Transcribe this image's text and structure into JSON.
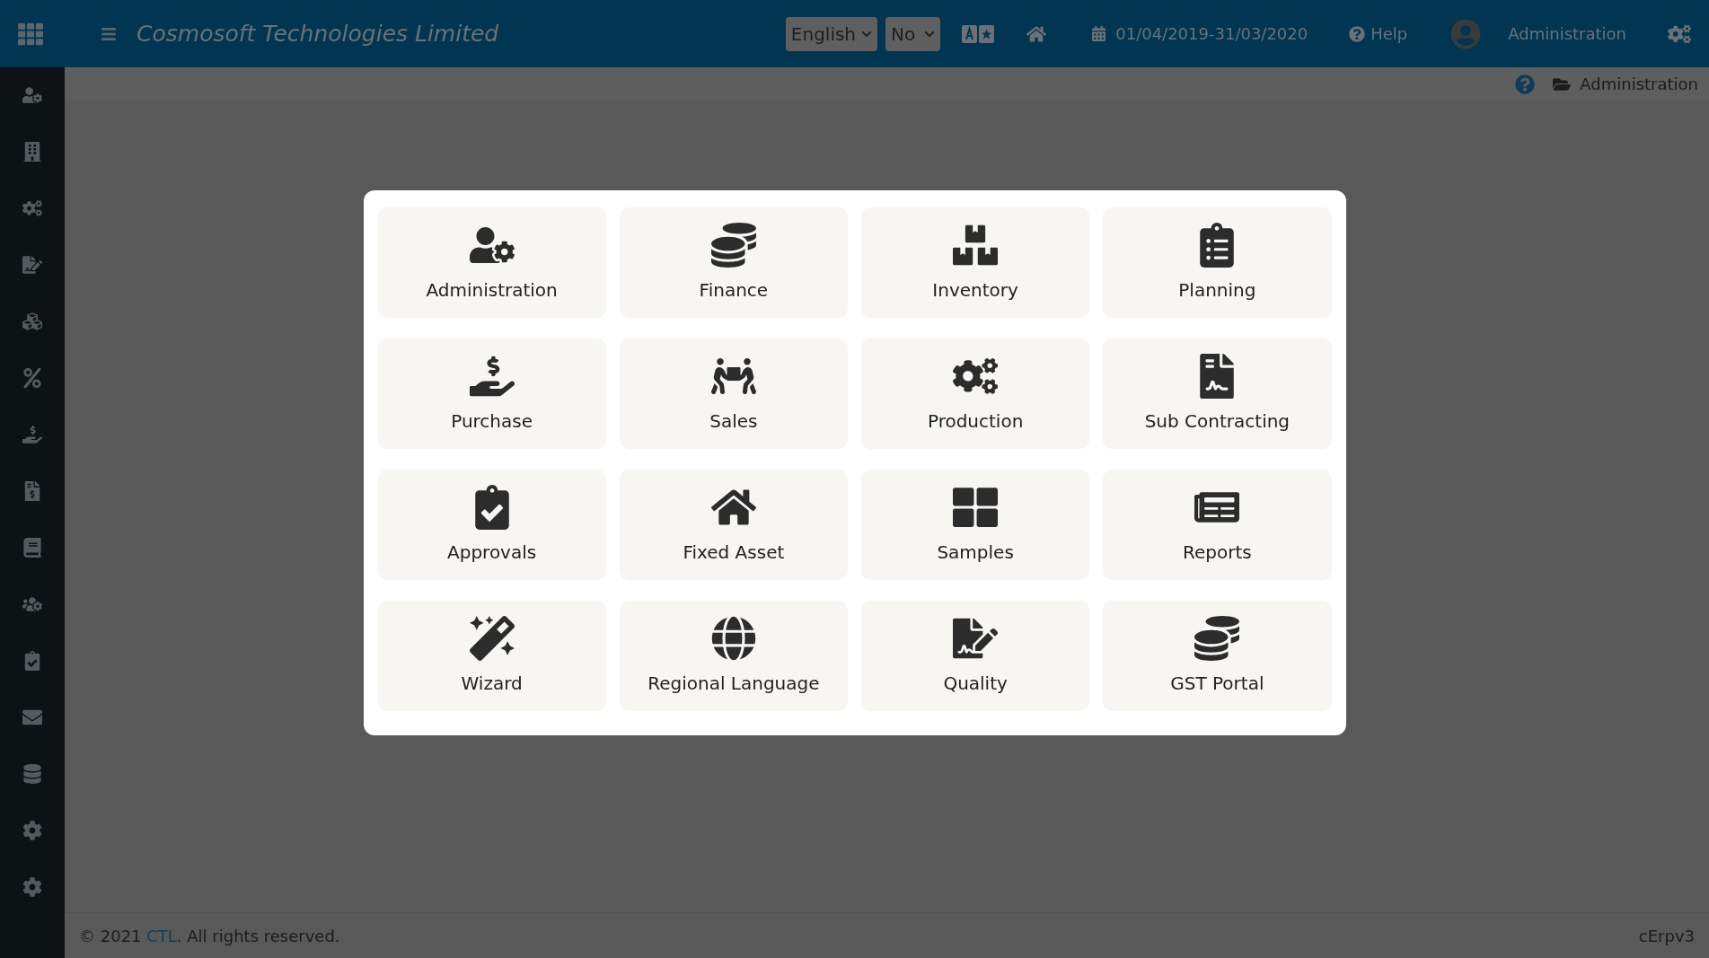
{
  "header": {
    "title": "Cosmosoft Technologies Limited",
    "language": "English",
    "option": "No",
    "date_range": "01/04/2019-31/03/2020",
    "help": "Help",
    "user": "Administration"
  },
  "breadcrumb": {
    "current": "Administration"
  },
  "modules": [
    {
      "label": "Administration"
    },
    {
      "label": "Finance"
    },
    {
      "label": "Inventory"
    },
    {
      "label": "Planning"
    },
    {
      "label": "Purchase"
    },
    {
      "label": "Sales"
    },
    {
      "label": "Production"
    },
    {
      "label": "Sub Contracting"
    },
    {
      "label": "Approvals"
    },
    {
      "label": "Fixed Asset"
    },
    {
      "label": "Samples"
    },
    {
      "label": "Reports"
    },
    {
      "label": "Wizard"
    },
    {
      "label": "Regional Language"
    },
    {
      "label": "Quality"
    },
    {
      "label": "GST Portal"
    }
  ],
  "footer": {
    "prefix": "© 2021 ",
    "link": "CTL",
    "suffix": ". All rights reserved.",
    "version": "cErpv3"
  }
}
